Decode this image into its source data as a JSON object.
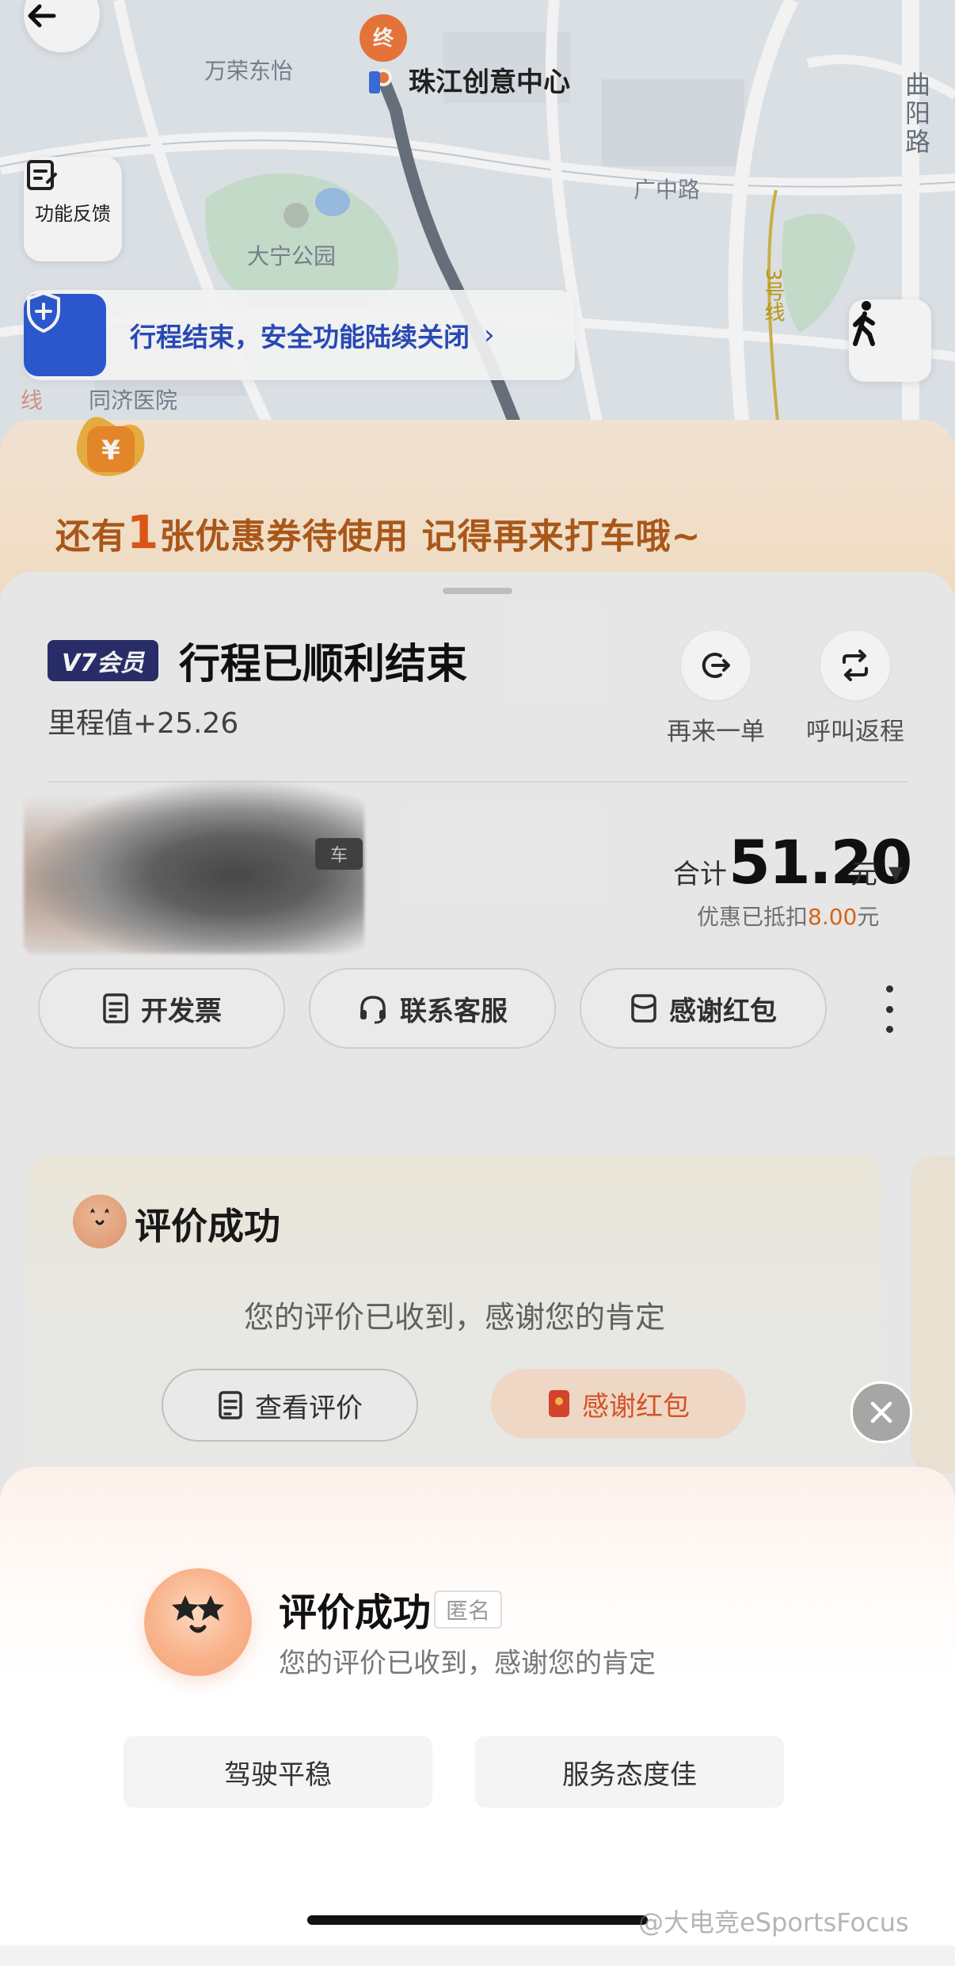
{
  "map": {
    "labels": {
      "poi_wanrong": "万荣东怡",
      "destination": "珠江创意中心",
      "park": "大宁公园",
      "guangzhong_road": "广中路",
      "quyang_road": "曲阳路",
      "metro_line_3": "3号线",
      "hospital": "同济医院",
      "line_fragment": "线",
      "end_marker": "终"
    },
    "feedback_label": "功能反馈",
    "safety_banner": "行程结束，安全功能陆续关闭",
    "colors": {
      "route": "#6b7480",
      "end_marker": "#f07a3c",
      "safety_blue": "#2f5bd6"
    }
  },
  "coupon": {
    "prefix": "还有",
    "count": "1",
    "suffix": "张优惠券待使用 记得再来打车哦~"
  },
  "trip": {
    "vip_badge": "V7会员",
    "title": "行程已顺利结束",
    "mileage": "里程值+25.26",
    "actions": {
      "reorder": "再来一单",
      "return_trip": "呼叫返程"
    },
    "plate_fragment": "车",
    "price": {
      "label": "合计",
      "amount": "51.20",
      "unit": "元",
      "discount_prefix": "优惠已抵扣",
      "discount_amount": "8.00",
      "discount_unit": "元"
    },
    "buttons": {
      "invoice": "开发票",
      "support": "联系客服",
      "thanks_red_packet": "感谢红包"
    }
  },
  "rating_card": {
    "title": "评价成功",
    "subtitle": "您的评价已收到，感谢您的肯定",
    "view_rating": "查看评价",
    "thanks_red_packet": "感谢红包"
  },
  "popup": {
    "title": "评价成功",
    "anonymous_tag": "匿名",
    "subtitle": "您的评价已收到，感谢您的肯定",
    "tags": [
      "驾驶平稳",
      "服务态度佳"
    ]
  },
  "watermark": "@大电竞eSportsFocus"
}
